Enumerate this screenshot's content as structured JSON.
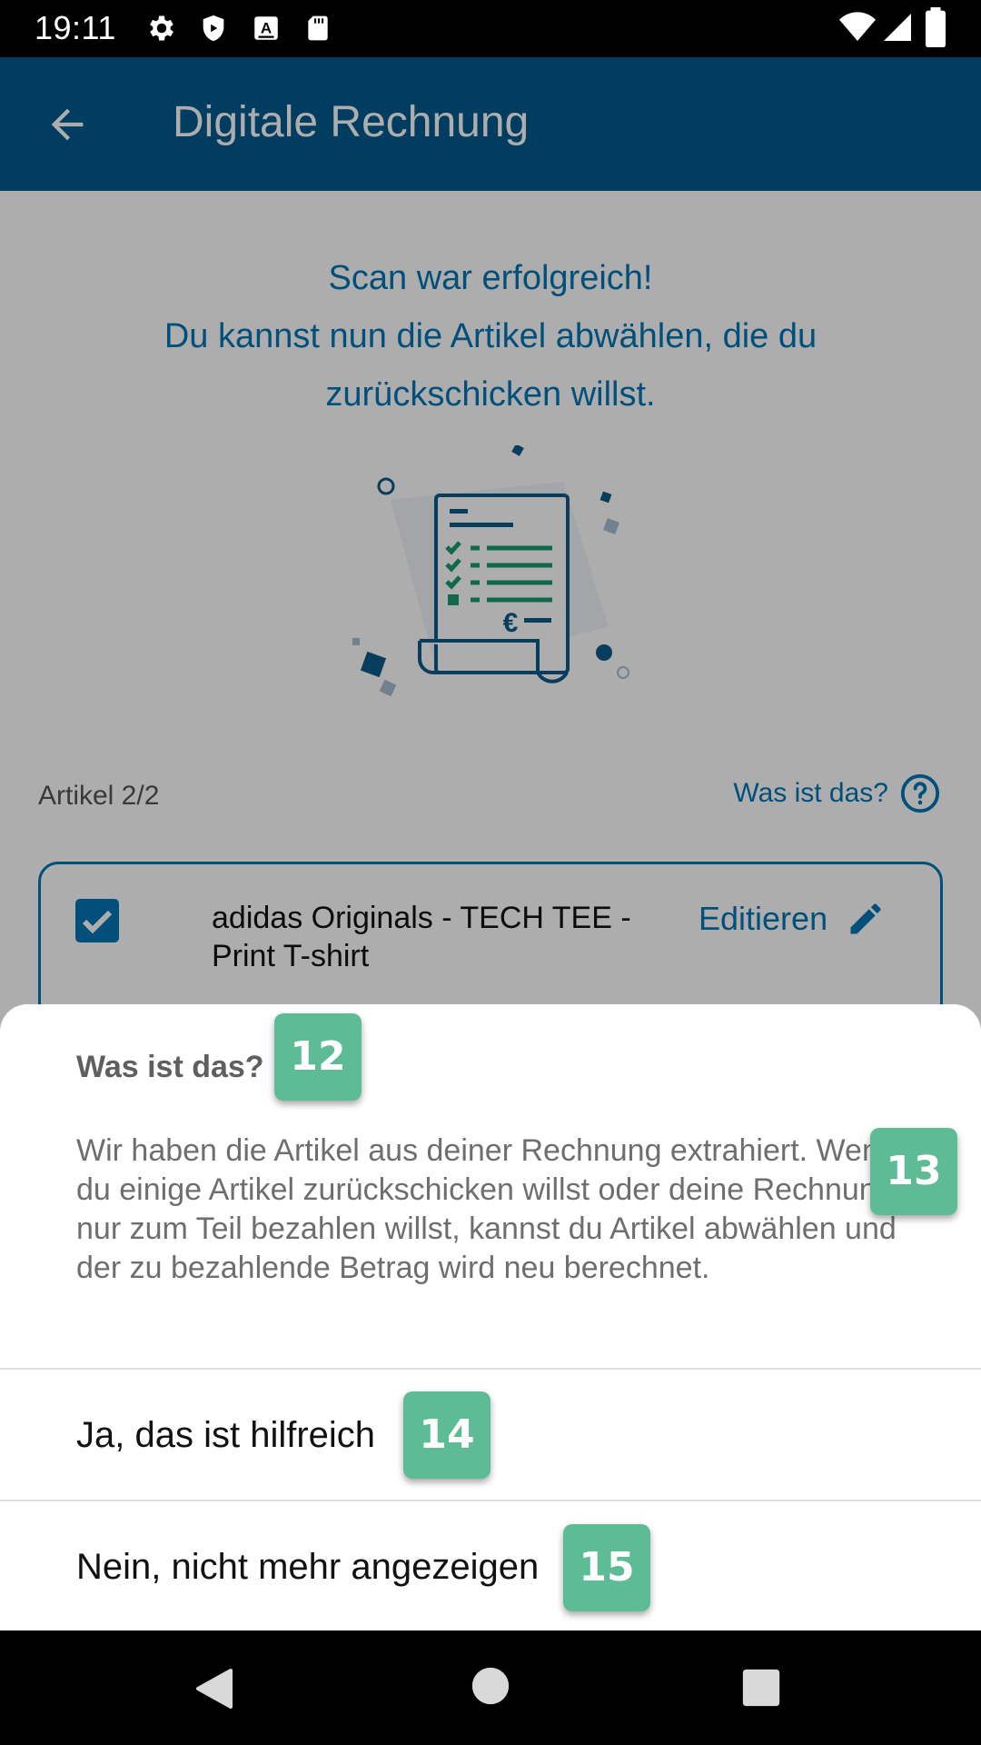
{
  "status_bar": {
    "time": "19:11",
    "icons": [
      "gear-icon",
      "shield-icon",
      "font-a-icon",
      "sd-card-icon",
      "wifi-icon",
      "signal-icon",
      "battery-icon"
    ]
  },
  "app_bar": {
    "title": "Digitale Rechnung",
    "back_icon": "arrow-left-icon",
    "color": "#005b8e"
  },
  "content": {
    "headline_line1": "Scan war erfolgreich!",
    "headline_line2": "Du kannst nun die Artikel abwählen, die du zurückschicken willst.",
    "article_count": "Artikel 2/2",
    "help_link": "Was ist das?",
    "item": {
      "checked": true,
      "title": "adidas Originals - TECH TEE - Print T-shirt",
      "edit_label": "Editieren"
    },
    "accent_color": "#0077b6"
  },
  "bottom_sheet": {
    "title": "Was ist das?",
    "body": "Wir haben die Artikel aus deiner Rechnung extrahiert. Wenn du einige Artikel zurückschicken willst oder deine Rechnung nur zum Teil bezahlen willst, kannst du Artikel abwählen und der zu bezahlende Betrag wird neu berechnet.",
    "option_yes": "Ja, das ist hilfreich",
    "option_no": "Nein, nicht mehr angezeigen"
  },
  "badges": {
    "title_badge": "12",
    "body_badge": "13",
    "yes_badge": "14",
    "no_badge": "15",
    "color": "#5dbb96"
  },
  "nav_bar": {
    "icons": [
      "back-triangle-icon",
      "home-circle-icon",
      "recents-square-icon"
    ]
  }
}
